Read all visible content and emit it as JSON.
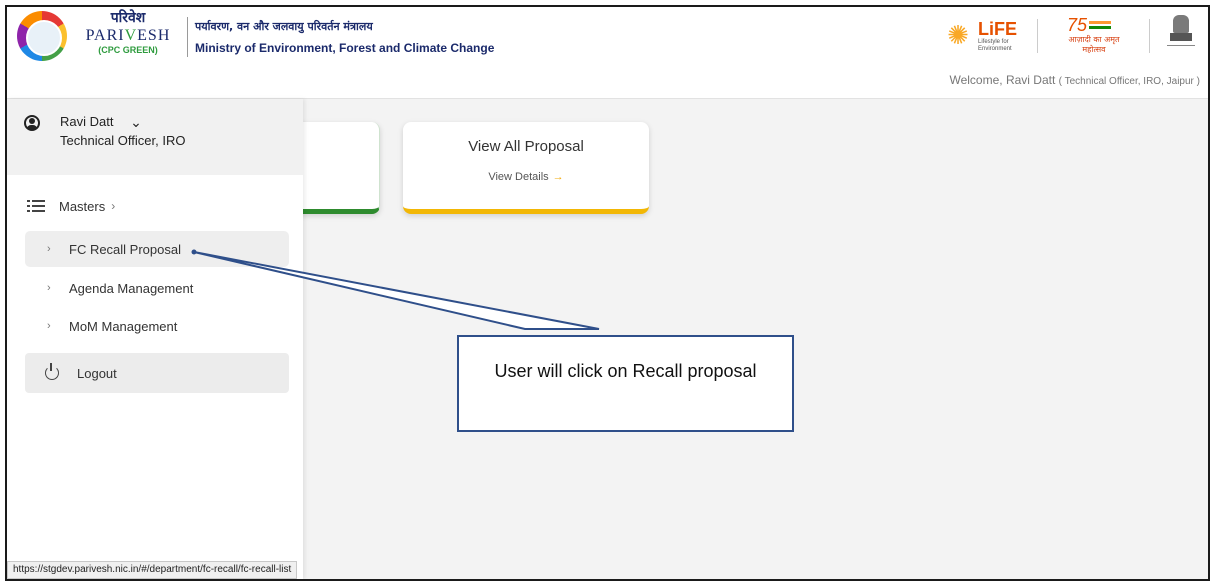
{
  "header": {
    "brand_hindi": "परिवेश",
    "brand_name_pre": "PARI",
    "brand_name_v": "V",
    "brand_name_post": "ESH",
    "brand_sub": "(CPC GREEN)",
    "ministry_hindi": "पर्यावरण, वन और जलवायु परिवर्तन मंत्रालय",
    "ministry_en": "Ministry of Environment, Forest and Climate Change",
    "life_word": "LiFE",
    "life_tag": "Lifestyle for Environment",
    "amrit_75": "75",
    "amrit_text": "आज़ादी का अमृत महोत्सव",
    "welcome_prefix": "Welcome, Ravi Datt",
    "welcome_role": "( Technical Officer, IRO,  Jaipur )"
  },
  "sidebar": {
    "user_name": "Ravi Datt",
    "user_role": "Technical Officer, IRO",
    "masters_label": "Masters",
    "chevron": "›",
    "items": [
      {
        "label": "FC Recall Proposal"
      },
      {
        "label": "Agenda Management"
      },
      {
        "label": "MoM Management"
      }
    ],
    "logout_label": "Logout"
  },
  "cards": {
    "view_all_title": "View All Proposal",
    "view_details": "View Details",
    "arrow": "→"
  },
  "callout": {
    "text": "User will click on Recall proposal"
  },
  "status_bar": {
    "url": "https://stgdev.parivesh.nic.in/#/department/fc-recall/fc-recall-list"
  },
  "colors": {
    "brand_navy": "#1b2a6b",
    "brand_green": "#2e9b3e",
    "card_green": "#2e8b2e",
    "card_yellow": "#f2b705",
    "callout_border": "#2f4f8a"
  },
  "icons": {
    "user": "user-circle-icon",
    "dropdown": "chevron-down-icon",
    "masters": "list-icon",
    "logout": "power-icon"
  }
}
